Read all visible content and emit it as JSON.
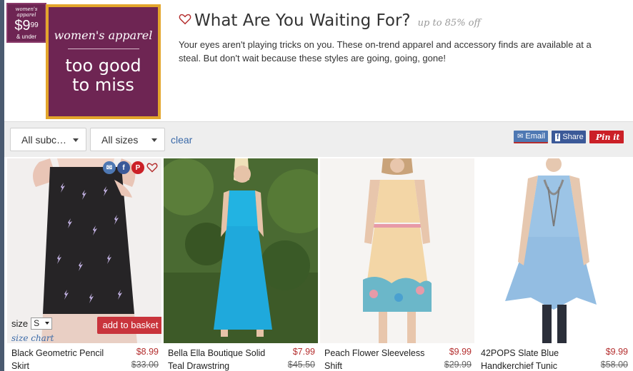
{
  "badge": {
    "line1": "women's apparel",
    "price_main": "$9",
    "price_cents": "99",
    "line3": "& under"
  },
  "hero": {
    "line1": "women's apparel",
    "line2": "too good",
    "line3": "to miss"
  },
  "header": {
    "title": "What Are You Waiting For?",
    "subtitle": "up to 85% off",
    "description": "Your eyes aren't playing tricks on you. These on-trend apparel and accessory finds are available at a steal. But don't wait because these styles are going, going, gone!"
  },
  "filters": {
    "subcategory": "All subc…",
    "sizes": "All sizes",
    "clear": "clear"
  },
  "share": {
    "email": "Email",
    "facebook": "Share",
    "pinterest": "Pin it"
  },
  "card_overlay": {
    "size_label": "size",
    "size_value": "S",
    "size_chart": "size chart",
    "add_to_basket": "add to basket"
  },
  "products": [
    {
      "name": "Black Geometric Pencil Skirt",
      "price": "$8.99",
      "was": "$33.00"
    },
    {
      "name": "Bella Ella Boutique Solid Teal Drawstring",
      "price": "$7.99",
      "was": "$45.50"
    },
    {
      "name": "Peach Flower Sleeveless Shift",
      "price": "$9.99",
      "was": "$29.99"
    },
    {
      "name": "42POPS Slate Blue Handkerchief Tunic",
      "price": "$9.99",
      "was": "$58.00"
    }
  ],
  "colors": {
    "plum": "#6e2553",
    "gold": "#e3a52c",
    "sale_red": "#b42e2e",
    "link_blue": "#3b6aa8"
  }
}
